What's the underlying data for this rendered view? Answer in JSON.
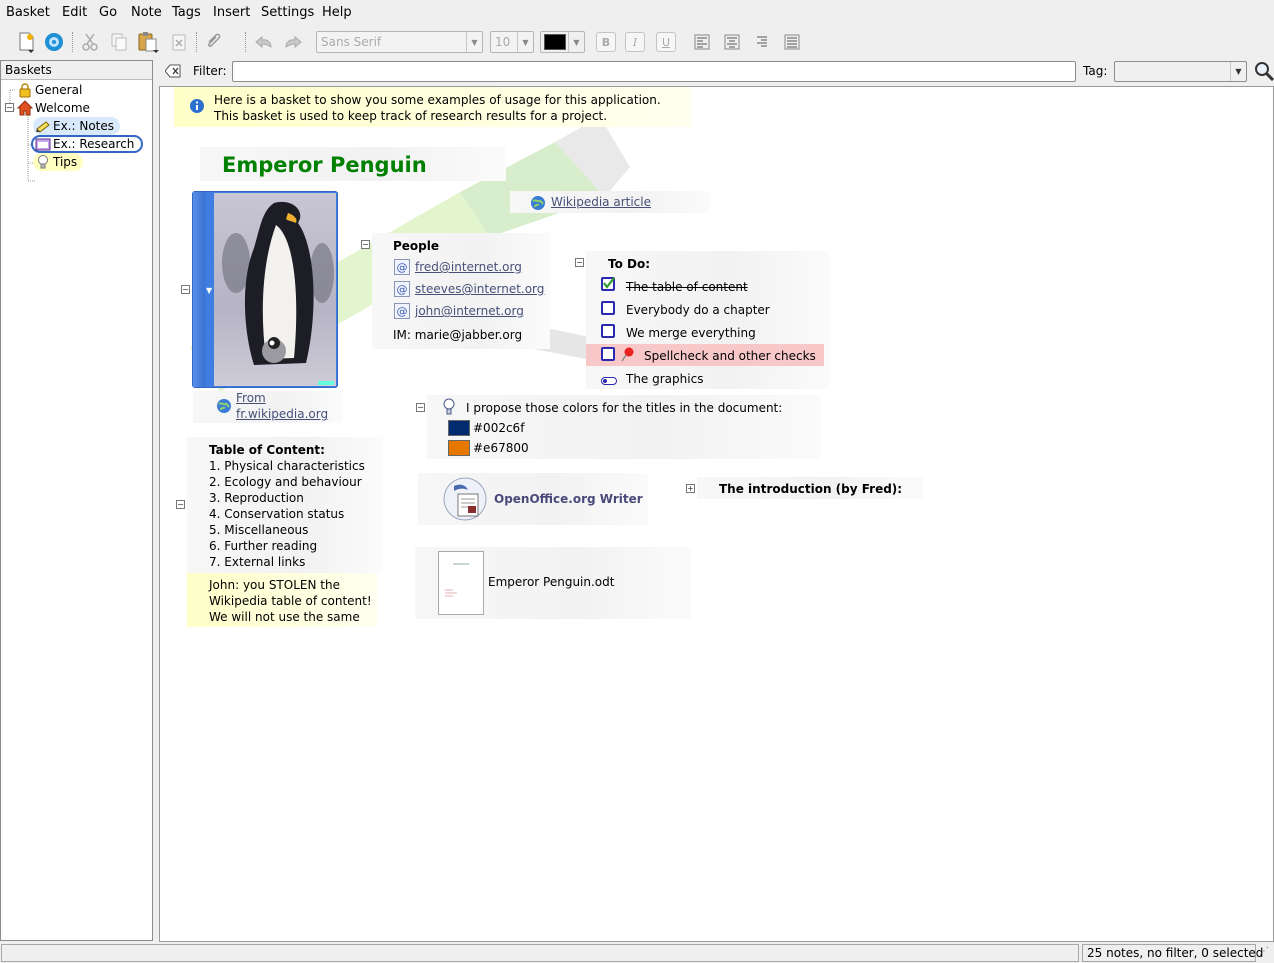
{
  "menubar": {
    "items": [
      "Basket",
      "Edit",
      "Go",
      "Note",
      "Tags",
      "Insert",
      "Settings",
      "Help"
    ]
  },
  "toolbar": {
    "font_family": "Sans Serif",
    "font_size": "10",
    "text_color": "#000000"
  },
  "sidebar": {
    "header": "Baskets",
    "items": [
      {
        "label": "General",
        "icon": "lock-icon"
      },
      {
        "label": "Welcome",
        "icon": "home-icon"
      },
      {
        "label": "Ex.: Notes",
        "icon": "notes-icon"
      },
      {
        "label": "Ex.: Research",
        "icon": "folder-icon"
      },
      {
        "label": "Tips",
        "icon": "lightbulb-icon"
      }
    ]
  },
  "filterbar": {
    "label": "Filter:",
    "value": "",
    "tag_label": "Tag:",
    "tag_value": ""
  },
  "basket": {
    "intro": {
      "line1": "Here is a basket to show you some examples of usage for this application.",
      "line2": "This basket is used to keep track of research results for a project."
    },
    "title": "Emperor Penguin",
    "title_color": "#008000",
    "wikipedia_link": "Wikipedia article",
    "image_source_line1": "From",
    "image_source_line2": "fr.wikipedia.org",
    "people": {
      "heading": "People",
      "emails": [
        "fred@internet.org",
        "steeves@internet.org",
        "john@internet.org"
      ],
      "im": "IM: marie@jabber.org"
    },
    "todo": {
      "heading": "To Do:",
      "items": [
        {
          "label": "The table of content",
          "done": true
        },
        {
          "label": "Everybody do a chapter",
          "done": false
        },
        {
          "label": "We merge everything",
          "done": false
        },
        {
          "label": "Spellcheck and other checks",
          "done": false,
          "important": true
        },
        {
          "label": "The graphics",
          "done": false
        }
      ]
    },
    "colors": {
      "heading": "I propose those colors for the titles in the document:",
      "swatches": [
        "#002c6f",
        "#e67800"
      ]
    },
    "toc": {
      "heading": "Table of Content:",
      "items": [
        "1. Physical characteristics",
        "2. Ecology and behaviour",
        "3. Reproduction",
        "4. Conservation status",
        "5. Miscellaneous",
        "6. Further reading",
        "7. External links"
      ],
      "comment_lines": [
        "John: you STOLEN the",
        "Wikipedia table of content!",
        "We will not use the same"
      ]
    },
    "openoffice": "OpenOffice.org Writer",
    "intro_fred": "The introduction (by Fred):",
    "odt_file": "Emperor Penguin.odt"
  },
  "statusbar": {
    "text": "25 notes, no filter, 0 selected"
  }
}
